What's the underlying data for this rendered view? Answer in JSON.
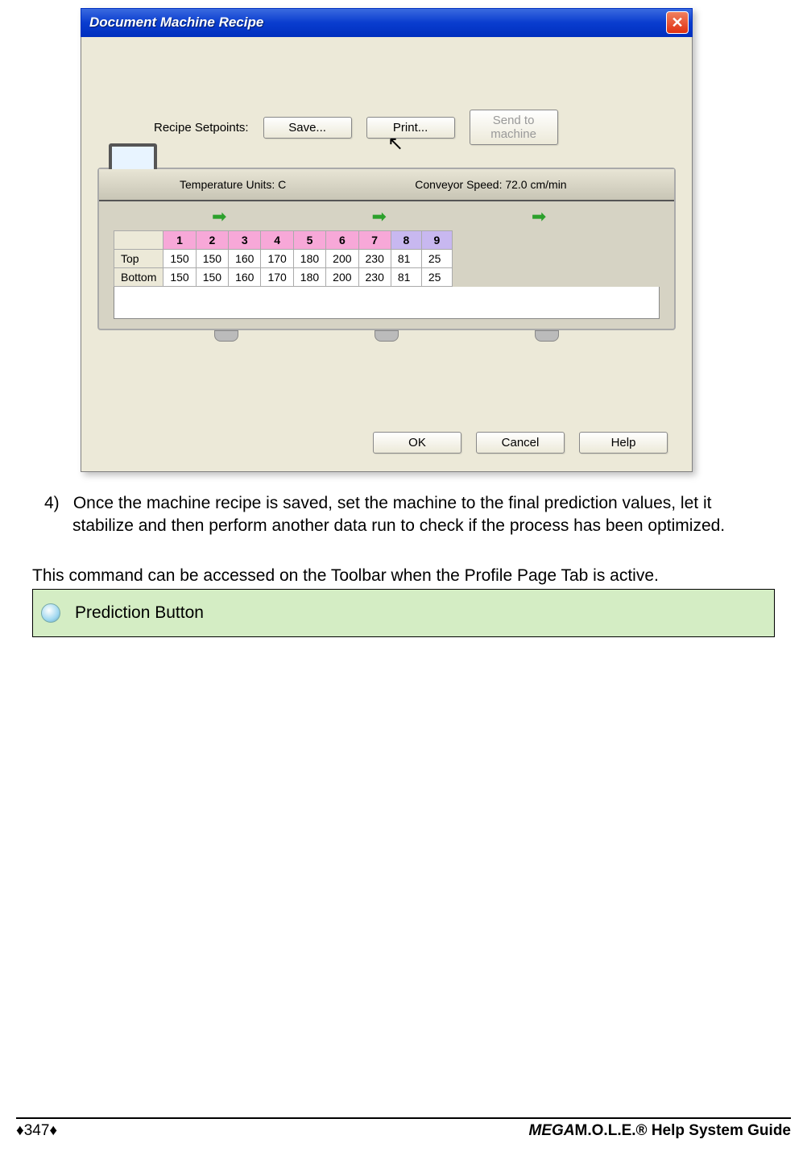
{
  "dialog": {
    "title": "Document Machine Recipe",
    "setpoints_label": "Recipe Setpoints:",
    "save_btn": "Save...",
    "print_btn": "Print...",
    "send_btn": "Send to machine",
    "temp_label": "Temperature Units: C",
    "conveyor_label": "Conveyor Speed: 72.0  cm/min",
    "ok_btn": "OK",
    "cancel_btn": "Cancel",
    "help_btn": "Help",
    "zones": {
      "headers": [
        "1",
        "2",
        "3",
        "4",
        "5",
        "6",
        "7",
        "8",
        "9"
      ],
      "header_classes": [
        "pink",
        "pink",
        "pink",
        "pink",
        "pink",
        "pink",
        "pink",
        "lav",
        "lav"
      ],
      "row_top_label": "Top",
      "row_bottom_label": "Bottom",
      "row_top": [
        "150",
        "150",
        "160",
        "170",
        "180",
        "200",
        "230",
        "81",
        "25"
      ],
      "row_bottom": [
        "150",
        "150",
        "160",
        "170",
        "180",
        "200",
        "230",
        "81",
        "25"
      ]
    }
  },
  "step": {
    "num": "4)",
    "text": "Once the machine recipe is saved, set the machine to the final prediction values, let it stabilize and then perform another data run to check if the process has been optimized."
  },
  "access_text": "This command can be accessed on the Toolbar when the Profile Page Tab is active.",
  "prediction_label": "Prediction Button",
  "footer": {
    "page": "♦347♦",
    "guide_prefix_italic": "MEGA",
    "guide_rest": "M.O.L.E.® Help System Guide"
  }
}
